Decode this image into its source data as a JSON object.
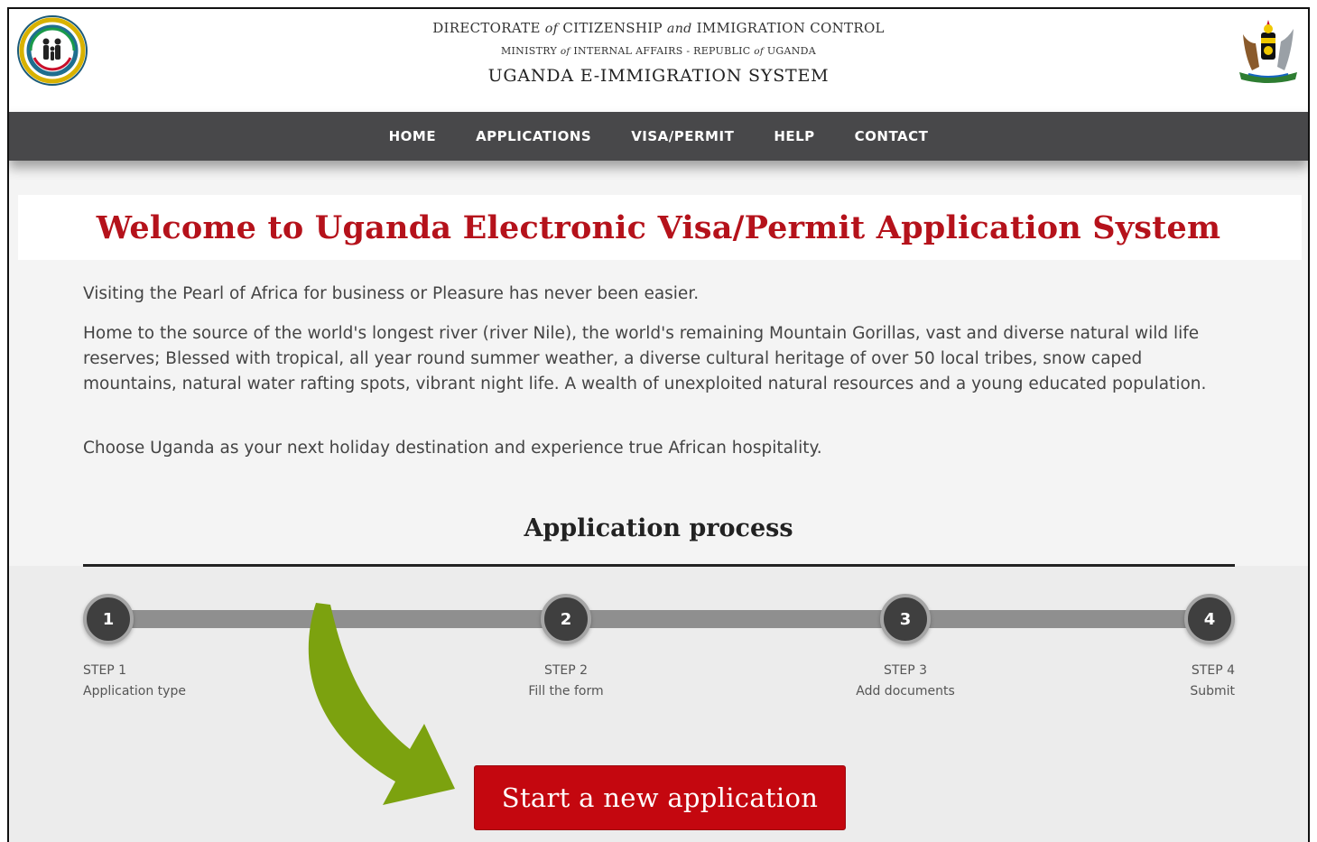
{
  "header": {
    "line1": {
      "a": "DIRECTORATE ",
      "b": "of",
      "c": " CITIZENSHIP ",
      "d": "and",
      "e": " IMMIGRATION CONTROL"
    },
    "line2": {
      "a": "MINISTRY ",
      "b": "of",
      "c": " INTERNAL AFFAIRS - REPUBLIC ",
      "d": "of",
      "e": " UGANDA"
    },
    "line3": "UGANDA E-IMMIGRATION SYSTEM",
    "left_logo_icon": "immigration-uganda-seal-icon",
    "right_logo_icon": "uganda-coat-of-arms-icon"
  },
  "nav": {
    "items": [
      {
        "label": "HOME"
      },
      {
        "label": "APPLICATIONS"
      },
      {
        "label": "VISA/PERMIT"
      },
      {
        "label": "HELP"
      },
      {
        "label": "CONTACT"
      }
    ]
  },
  "welcome": {
    "title": "Welcome to Uganda Electronic Visa/Permit Application System",
    "paragraphs": [
      "Visiting the Pearl of Africa for business or Pleasure has never been easier.",
      "Home to the source of the world's longest river (river Nile), the world's remaining Mountain Gorillas, vast and diverse natural wild life reserves; Blessed with tropical, all year round summer weather, a diverse cultural heritage of over 50 local tribes, snow caped mountains, natural water rafting spots, vibrant night life. A wealth of unexploited natural resources and a young educated population.",
      "Choose Uganda as your next holiday destination and experience true African hospitality."
    ]
  },
  "process": {
    "title": "Application process",
    "steps": [
      {
        "number": "1",
        "step": "STEP 1",
        "label": "Application type"
      },
      {
        "number": "2",
        "step": "STEP 2",
        "label": "Fill the form"
      },
      {
        "number": "3",
        "step": "STEP 3",
        "label": "Add documents"
      },
      {
        "number": "4",
        "step": "STEP 4",
        "label": "Submit"
      }
    ]
  },
  "cta": {
    "label": "Start a new application"
  },
  "colors": {
    "brand_red": "#b5121b",
    "button_red": "#c4070f",
    "nav_bg": "#48484a",
    "arrow_green": "#7ca20f"
  },
  "annotation_icon": "curved-arrow-icon"
}
